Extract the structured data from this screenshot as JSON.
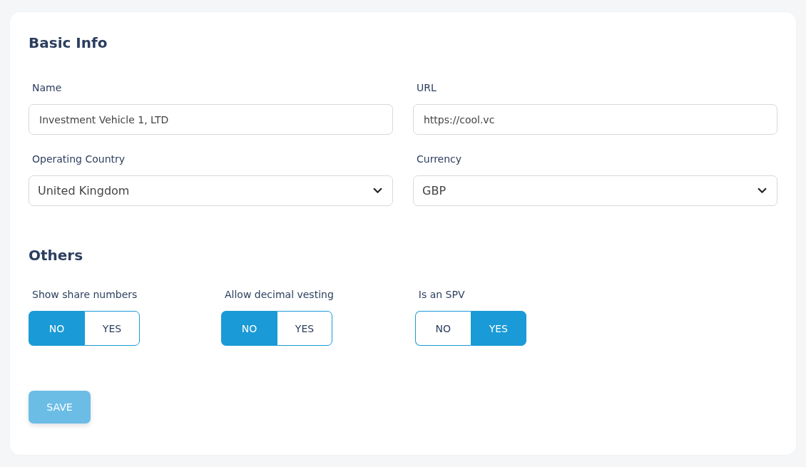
{
  "sections": [
    {
      "title": "Basic Info",
      "kind": "fields",
      "fields": [
        {
          "label": "Name",
          "kind": "text",
          "value": "Investment Vehicle 1, LTD"
        },
        {
          "label": "URL",
          "kind": "text",
          "value": "https://cool.vc"
        },
        {
          "label": "Operating Country",
          "kind": "select",
          "value": "United Kingdom"
        },
        {
          "label": "Currency",
          "kind": "select",
          "value": "GBP"
        }
      ]
    },
    {
      "title": "Others",
      "kind": "toggles",
      "toggles": [
        {
          "label": "Show share numbers",
          "options": [
            {
              "label": "NO",
              "selected": true
            },
            {
              "label": "YES",
              "selected": false
            }
          ]
        },
        {
          "label": "Allow decimal vesting",
          "options": [
            {
              "label": "NO",
              "selected": true
            },
            {
              "label": "YES",
              "selected": false
            }
          ]
        },
        {
          "label": "Is an SPV",
          "options": [
            {
              "label": "NO",
              "selected": false
            },
            {
              "label": "YES",
              "selected": true
            }
          ]
        }
      ]
    }
  ],
  "save_button": {
    "label": "SAVE",
    "disabled": true
  }
}
